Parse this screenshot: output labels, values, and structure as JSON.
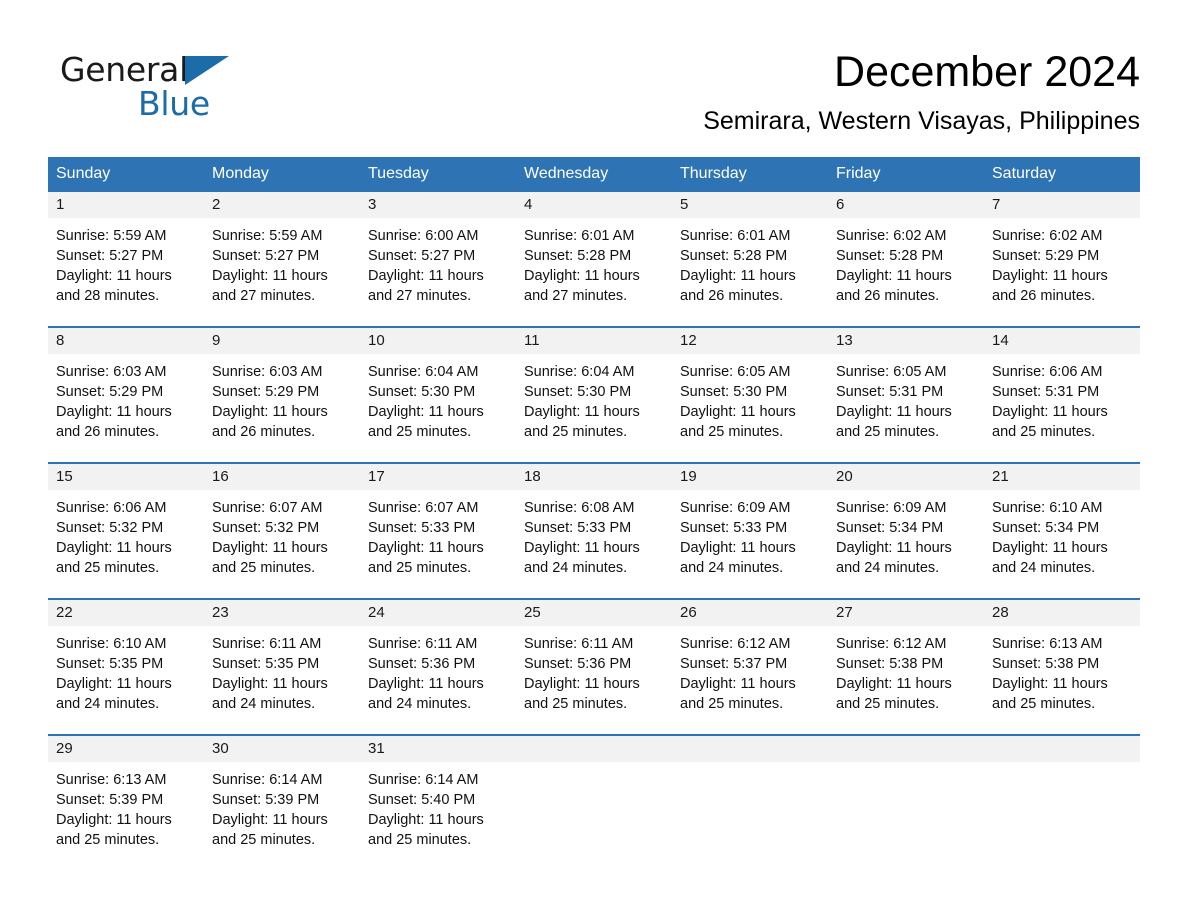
{
  "brand": {
    "name_part1": "General",
    "name_part2": "Blue",
    "accent_color": "#1b6ca8"
  },
  "header": {
    "title": "December 2024",
    "subtitle": "Semirara, Western Visayas, Philippines"
  },
  "theme": {
    "header_blue": "#2e74b5",
    "daynum_band": "#f2f2f2"
  },
  "weekday_headers": [
    "Sunday",
    "Monday",
    "Tuesday",
    "Wednesday",
    "Thursday",
    "Friday",
    "Saturday"
  ],
  "weeks": [
    [
      {
        "day": "1",
        "sunrise": "Sunrise: 5:59 AM",
        "sunset": "Sunset: 5:27 PM",
        "daylight1": "Daylight: 11 hours",
        "daylight2": "and 28 minutes."
      },
      {
        "day": "2",
        "sunrise": "Sunrise: 5:59 AM",
        "sunset": "Sunset: 5:27 PM",
        "daylight1": "Daylight: 11 hours",
        "daylight2": "and 27 minutes."
      },
      {
        "day": "3",
        "sunrise": "Sunrise: 6:00 AM",
        "sunset": "Sunset: 5:27 PM",
        "daylight1": "Daylight: 11 hours",
        "daylight2": "and 27 minutes."
      },
      {
        "day": "4",
        "sunrise": "Sunrise: 6:01 AM",
        "sunset": "Sunset: 5:28 PM",
        "daylight1": "Daylight: 11 hours",
        "daylight2": "and 27 minutes."
      },
      {
        "day": "5",
        "sunrise": "Sunrise: 6:01 AM",
        "sunset": "Sunset: 5:28 PM",
        "daylight1": "Daylight: 11 hours",
        "daylight2": "and 26 minutes."
      },
      {
        "day": "6",
        "sunrise": "Sunrise: 6:02 AM",
        "sunset": "Sunset: 5:28 PM",
        "daylight1": "Daylight: 11 hours",
        "daylight2": "and 26 minutes."
      },
      {
        "day": "7",
        "sunrise": "Sunrise: 6:02 AM",
        "sunset": "Sunset: 5:29 PM",
        "daylight1": "Daylight: 11 hours",
        "daylight2": "and 26 minutes."
      }
    ],
    [
      {
        "day": "8",
        "sunrise": "Sunrise: 6:03 AM",
        "sunset": "Sunset: 5:29 PM",
        "daylight1": "Daylight: 11 hours",
        "daylight2": "and 26 minutes."
      },
      {
        "day": "9",
        "sunrise": "Sunrise: 6:03 AM",
        "sunset": "Sunset: 5:29 PM",
        "daylight1": "Daylight: 11 hours",
        "daylight2": "and 26 minutes."
      },
      {
        "day": "10",
        "sunrise": "Sunrise: 6:04 AM",
        "sunset": "Sunset: 5:30 PM",
        "daylight1": "Daylight: 11 hours",
        "daylight2": "and 25 minutes."
      },
      {
        "day": "11",
        "sunrise": "Sunrise: 6:04 AM",
        "sunset": "Sunset: 5:30 PM",
        "daylight1": "Daylight: 11 hours",
        "daylight2": "and 25 minutes."
      },
      {
        "day": "12",
        "sunrise": "Sunrise: 6:05 AM",
        "sunset": "Sunset: 5:30 PM",
        "daylight1": "Daylight: 11 hours",
        "daylight2": "and 25 minutes."
      },
      {
        "day": "13",
        "sunrise": "Sunrise: 6:05 AM",
        "sunset": "Sunset: 5:31 PM",
        "daylight1": "Daylight: 11 hours",
        "daylight2": "and 25 minutes."
      },
      {
        "day": "14",
        "sunrise": "Sunrise: 6:06 AM",
        "sunset": "Sunset: 5:31 PM",
        "daylight1": "Daylight: 11 hours",
        "daylight2": "and 25 minutes."
      }
    ],
    [
      {
        "day": "15",
        "sunrise": "Sunrise: 6:06 AM",
        "sunset": "Sunset: 5:32 PM",
        "daylight1": "Daylight: 11 hours",
        "daylight2": "and 25 minutes."
      },
      {
        "day": "16",
        "sunrise": "Sunrise: 6:07 AM",
        "sunset": "Sunset: 5:32 PM",
        "daylight1": "Daylight: 11 hours",
        "daylight2": "and 25 minutes."
      },
      {
        "day": "17",
        "sunrise": "Sunrise: 6:07 AM",
        "sunset": "Sunset: 5:33 PM",
        "daylight1": "Daylight: 11 hours",
        "daylight2": "and 25 minutes."
      },
      {
        "day": "18",
        "sunrise": "Sunrise: 6:08 AM",
        "sunset": "Sunset: 5:33 PM",
        "daylight1": "Daylight: 11 hours",
        "daylight2": "and 24 minutes."
      },
      {
        "day": "19",
        "sunrise": "Sunrise: 6:09 AM",
        "sunset": "Sunset: 5:33 PM",
        "daylight1": "Daylight: 11 hours",
        "daylight2": "and 24 minutes."
      },
      {
        "day": "20",
        "sunrise": "Sunrise: 6:09 AM",
        "sunset": "Sunset: 5:34 PM",
        "daylight1": "Daylight: 11 hours",
        "daylight2": "and 24 minutes."
      },
      {
        "day": "21",
        "sunrise": "Sunrise: 6:10 AM",
        "sunset": "Sunset: 5:34 PM",
        "daylight1": "Daylight: 11 hours",
        "daylight2": "and 24 minutes."
      }
    ],
    [
      {
        "day": "22",
        "sunrise": "Sunrise: 6:10 AM",
        "sunset": "Sunset: 5:35 PM",
        "daylight1": "Daylight: 11 hours",
        "daylight2": "and 24 minutes."
      },
      {
        "day": "23",
        "sunrise": "Sunrise: 6:11 AM",
        "sunset": "Sunset: 5:35 PM",
        "daylight1": "Daylight: 11 hours",
        "daylight2": "and 24 minutes."
      },
      {
        "day": "24",
        "sunrise": "Sunrise: 6:11 AM",
        "sunset": "Sunset: 5:36 PM",
        "daylight1": "Daylight: 11 hours",
        "daylight2": "and 24 minutes."
      },
      {
        "day": "25",
        "sunrise": "Sunrise: 6:11 AM",
        "sunset": "Sunset: 5:36 PM",
        "daylight1": "Daylight: 11 hours",
        "daylight2": "and 25 minutes."
      },
      {
        "day": "26",
        "sunrise": "Sunrise: 6:12 AM",
        "sunset": "Sunset: 5:37 PM",
        "daylight1": "Daylight: 11 hours",
        "daylight2": "and 25 minutes."
      },
      {
        "day": "27",
        "sunrise": "Sunrise: 6:12 AM",
        "sunset": "Sunset: 5:38 PM",
        "daylight1": "Daylight: 11 hours",
        "daylight2": "and 25 minutes."
      },
      {
        "day": "28",
        "sunrise": "Sunrise: 6:13 AM",
        "sunset": "Sunset: 5:38 PM",
        "daylight1": "Daylight: 11 hours",
        "daylight2": "and 25 minutes."
      }
    ],
    [
      {
        "day": "29",
        "sunrise": "Sunrise: 6:13 AM",
        "sunset": "Sunset: 5:39 PM",
        "daylight1": "Daylight: 11 hours",
        "daylight2": "and 25 minutes."
      },
      {
        "day": "30",
        "sunrise": "Sunrise: 6:14 AM",
        "sunset": "Sunset: 5:39 PM",
        "daylight1": "Daylight: 11 hours",
        "daylight2": "and 25 minutes."
      },
      {
        "day": "31",
        "sunrise": "Sunrise: 6:14 AM",
        "sunset": "Sunset: 5:40 PM",
        "daylight1": "Daylight: 11 hours",
        "daylight2": "and 25 minutes."
      },
      {
        "day": "",
        "sunrise": "",
        "sunset": "",
        "daylight1": "",
        "daylight2": ""
      },
      {
        "day": "",
        "sunrise": "",
        "sunset": "",
        "daylight1": "",
        "daylight2": ""
      },
      {
        "day": "",
        "sunrise": "",
        "sunset": "",
        "daylight1": "",
        "daylight2": ""
      },
      {
        "day": "",
        "sunrise": "",
        "sunset": "",
        "daylight1": "",
        "daylight2": ""
      }
    ]
  ]
}
